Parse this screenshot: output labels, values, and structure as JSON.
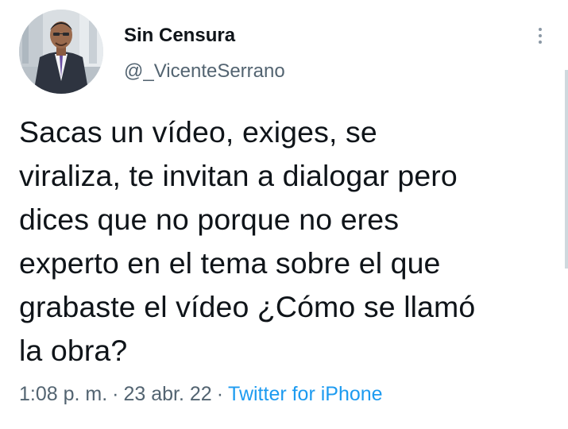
{
  "tweet": {
    "author": {
      "display_name": "Sin Censura",
      "handle": "@_VicenteSerrano"
    },
    "text_lines": [
      "Sacas un vídeo, exiges, se",
      "viraliza, te invitan a dialogar pero",
      "dices que no porque no eres",
      "experto en el tema sobre el que",
      "grabaste el vídeo ¿Cómo se llamó",
      "la obra?"
    ],
    "meta": {
      "time": "1:08 p. m.",
      "separator": "·",
      "date": "23 abr. 22",
      "source": "Twitter for iPhone"
    },
    "more_icon": "more-vertical-icon"
  },
  "colors": {
    "text_primary": "#0f1419",
    "text_secondary": "#536471",
    "link_accent": "#1d9bf0",
    "background": "#ffffff"
  }
}
